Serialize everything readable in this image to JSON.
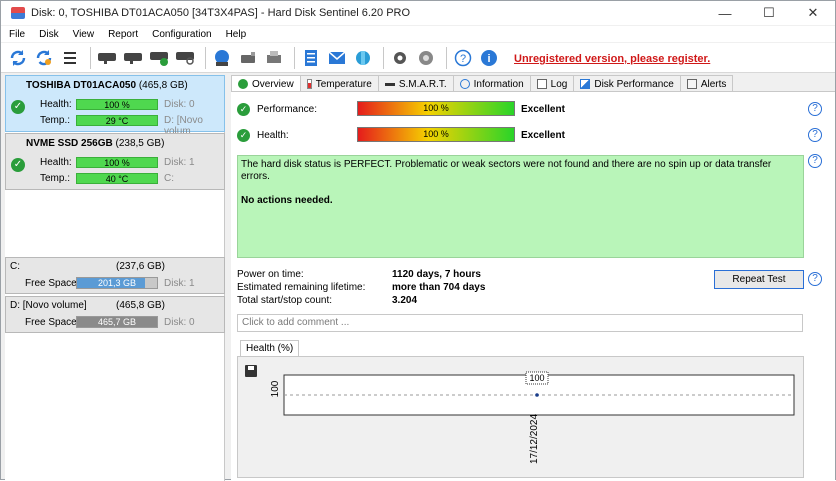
{
  "window": {
    "title": "Disk: 0, TOSHIBA DT01ACA050 [34T3X4PAS] - Hard Disk Sentinel 6.20 PRO",
    "controls": [
      "—",
      "☐",
      "✕"
    ]
  },
  "menu": [
    "File",
    "Disk",
    "View",
    "Report",
    "Configuration",
    "Help"
  ],
  "toolbar": {
    "unregistered_text": "Unregistered version, please register."
  },
  "disks": [
    {
      "name": "TOSHIBA DT01ACA050",
      "size": "(465,8 GB)",
      "health_label": "Health:",
      "health_value": "100 %",
      "health_fraction": 1.0,
      "temp_label": "Temp.:",
      "temp_value": "29 °C",
      "side1": "Disk: 0",
      "side2": "D: [Novo volum"
    },
    {
      "name": "NVME SSD 256GB",
      "size": "(238,5 GB)",
      "health_label": "Health:",
      "health_value": "100 %",
      "health_fraction": 1.0,
      "temp_label": "Temp.:",
      "temp_value": "40 °C",
      "side1": "Disk: 1",
      "side2": "C:"
    }
  ],
  "volumes": [
    {
      "name": "C:",
      "size": "(237,6 GB)",
      "free_label": "Free Space",
      "free_value": "201,3 GB",
      "free_fraction": 0.85,
      "disk": "Disk: 1"
    },
    {
      "name": "D: [Novo volume]",
      "size": "(465,8 GB)",
      "free_label": "Free Space",
      "free_value": "465,7 GB",
      "free_fraction": 1.0,
      "disk": "Disk: 0"
    }
  ],
  "tabs": [
    "Overview",
    "Temperature",
    "S.M.A.R.T.",
    "Information",
    "Log",
    "Disk Performance",
    "Alerts"
  ],
  "overview": {
    "performance_label": "Performance:",
    "performance_value": "100 %",
    "performance_rating": "Excellent",
    "health_label": "Health:",
    "health_value": "100 %",
    "health_rating": "Excellent",
    "status_text": "The hard disk status is PERFECT. Problematic or weak sectors were not found and there are no spin up or data transfer errors.",
    "action_text": "No actions needed.",
    "power_on_label": "Power on time:",
    "power_on_value": "1120 days, 7 hours",
    "lifetime_label": "Estimated remaining lifetime:",
    "lifetime_value": "more than 704 days",
    "startstop_label": "Total start/stop count:",
    "startstop_value": "3.204",
    "repeat_button": "Repeat Test",
    "comment_placeholder": "Click to add comment ..."
  },
  "chart_data": {
    "type": "line",
    "title": "Health (%)",
    "x": [
      "17/12/2024"
    ],
    "series": [
      {
        "values": [
          100
        ]
      }
    ],
    "data_labels": [
      "100"
    ],
    "y_tick_labels": [
      "100"
    ],
    "grid": true
  }
}
